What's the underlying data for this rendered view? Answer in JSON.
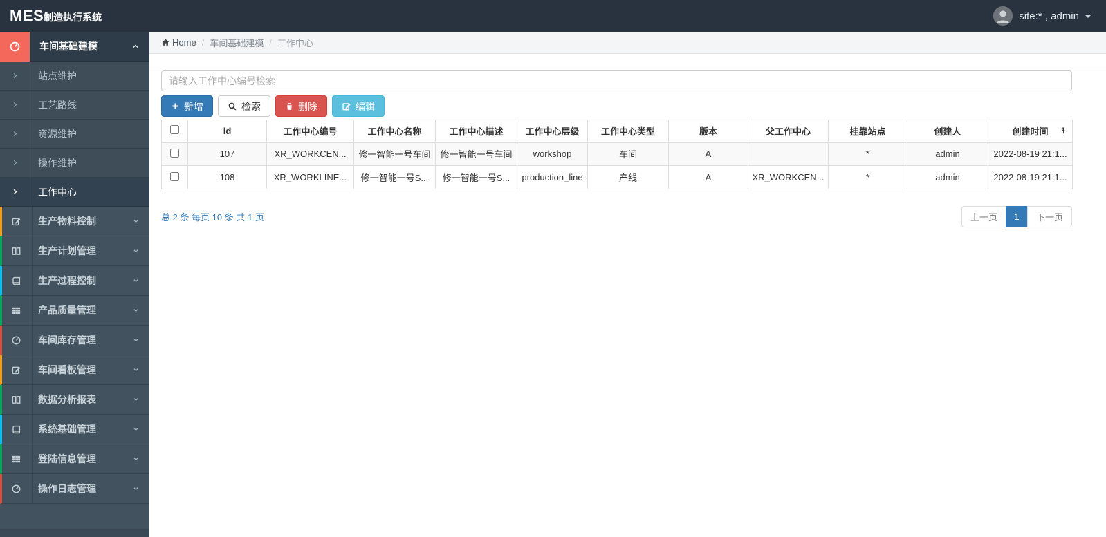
{
  "topbar": {
    "logo_bold": "MES",
    "logo_rest": "制造执行系统",
    "user_label": "site:* , admin"
  },
  "breadcrumb": {
    "home": "Home",
    "section": "车间基础建模",
    "current": "工作中心"
  },
  "sidebar": {
    "parent": {
      "label": "车间基础建模",
      "icon": "dashboard-icon"
    },
    "submenu": [
      "站点维护",
      "工艺路线",
      "资源维护",
      "操作维护",
      "工作中心"
    ],
    "active_submenu": "工作中心",
    "sections": [
      {
        "label": "生产物料控制",
        "icon": "edit-icon",
        "strip": "#f39c12"
      },
      {
        "label": "生产计划管理",
        "icon": "columns-icon",
        "strip": "#00a65a"
      },
      {
        "label": "生产过程控制",
        "icon": "book-icon",
        "strip": "#00c0ef"
      },
      {
        "label": "产品质量管理",
        "icon": "list-icon",
        "strip": "#00a65a"
      },
      {
        "label": "车间库存管理",
        "icon": "dashboard-icon",
        "strip": "#dd4b39"
      },
      {
        "label": "车间看板管理",
        "icon": "edit-icon",
        "strip": "#f39c12"
      },
      {
        "label": "数据分析报表",
        "icon": "columns-icon",
        "strip": "#00a65a"
      },
      {
        "label": "系统基础管理",
        "icon": "book-icon",
        "strip": "#00c0ef"
      },
      {
        "label": "登陆信息管理",
        "icon": "list-icon",
        "strip": "#00a65a"
      },
      {
        "label": "操作日志管理",
        "icon": "dashboard-icon",
        "strip": "#dd4b39"
      }
    ]
  },
  "search": {
    "placeholder": "请输入工作中心编号检索"
  },
  "toolbar": {
    "add": "新增",
    "search": "检索",
    "delete": "删除",
    "edit": "编辑"
  },
  "table": {
    "headers": [
      "id",
      "工作中心编号",
      "工作中心名称",
      "工作中心描述",
      "工作中心层级",
      "工作中心类型",
      "版本",
      "父工作中心",
      "挂靠站点",
      "创建人",
      "创建时间"
    ],
    "rows": [
      {
        "id": "107",
        "code": "XR_WORKCEN...",
        "name": "修一智能一号车间",
        "desc": "修一智能一号车间",
        "level": "workshop",
        "type": "车间",
        "version": "A",
        "parent": "",
        "station": "*",
        "creator": "admin",
        "created": "2022-08-19 21:1..."
      },
      {
        "id": "108",
        "code": "XR_WORKLINE...",
        "name": "修一智能一号S...",
        "desc": "修一智能一号S...",
        "level": "production_line",
        "type": "产线",
        "version": "A",
        "parent": "XR_WORKCEN...",
        "station": "*",
        "creator": "admin",
        "created": "2022-08-19 21:1..."
      }
    ]
  },
  "pagination": {
    "summary": "总 2 条  每页 10 条  共 1 页",
    "prev": "上一页",
    "current": "1",
    "next": "下一页"
  },
  "colors": {
    "primary": "#337ab7",
    "danger": "#d9534f",
    "info": "#5bc0de",
    "sidebar_accent": "#f4685c",
    "topbar": "#28333f",
    "sidebar": "#42525e"
  }
}
